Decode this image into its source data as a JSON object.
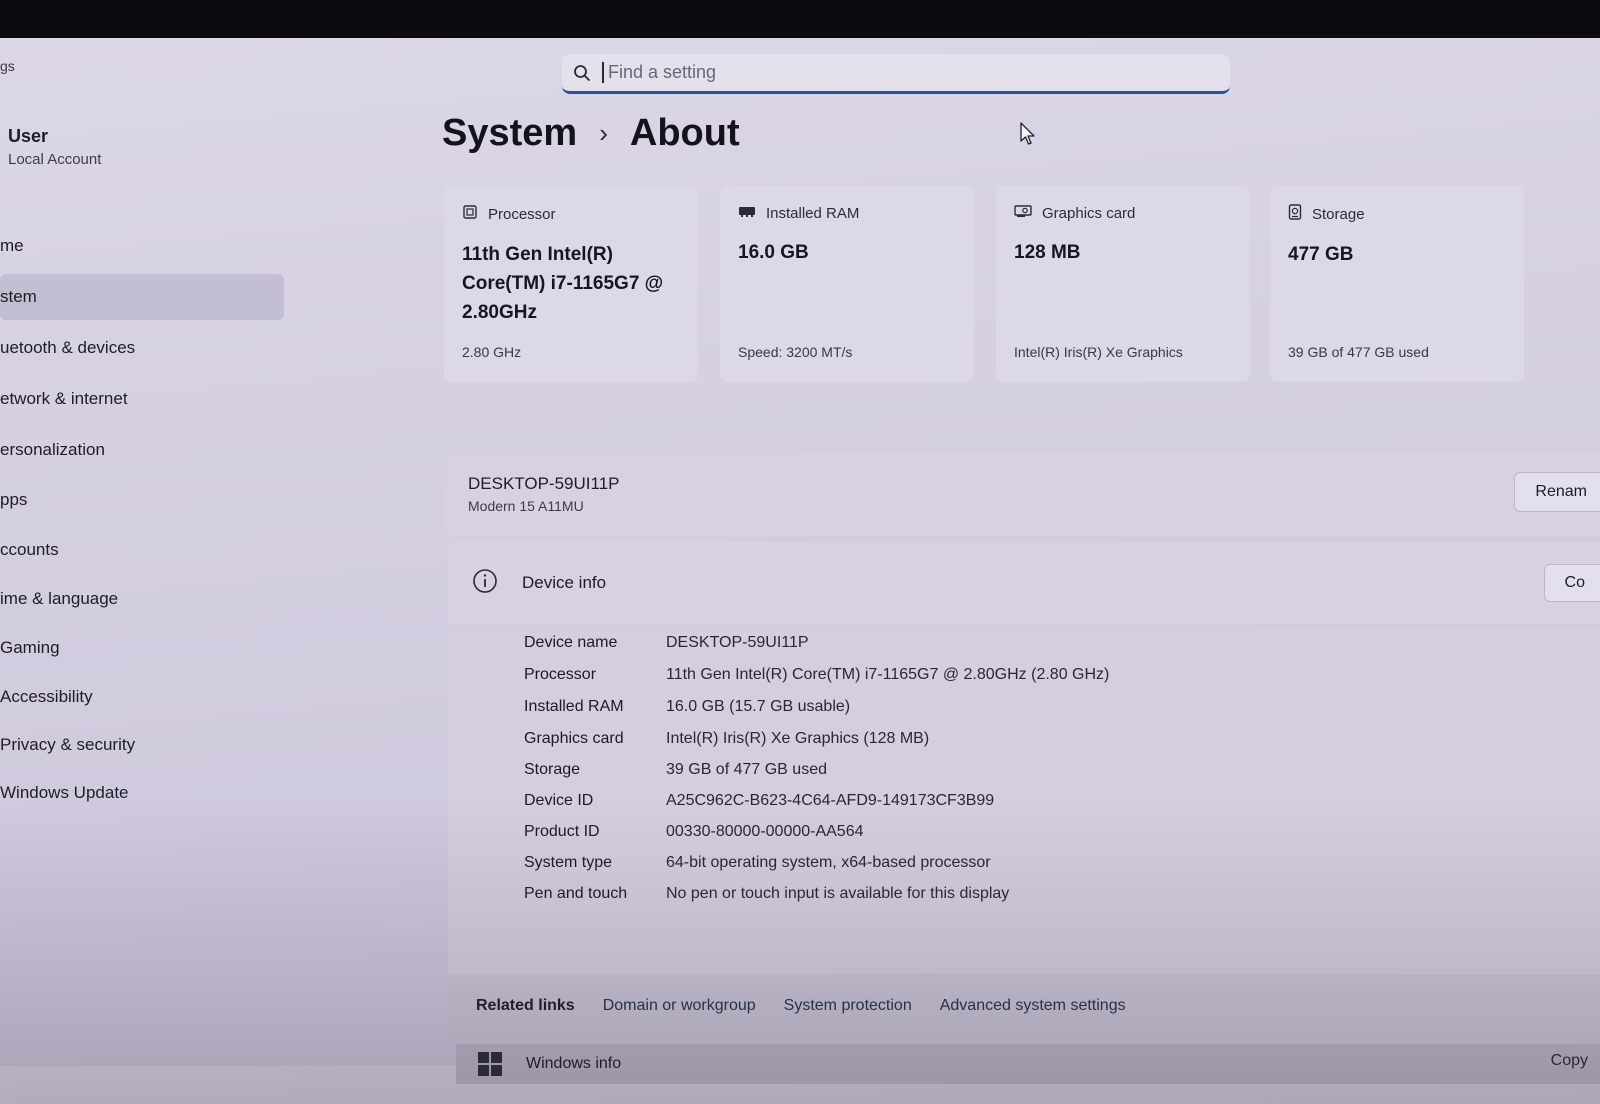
{
  "app": {
    "title_fragment": "gs"
  },
  "search": {
    "placeholder": "Find a setting"
  },
  "profile": {
    "name": "User",
    "account_type": "Local Account"
  },
  "sidebar": {
    "items": [
      {
        "label": "me",
        "active": false
      },
      {
        "label": "stem",
        "active": true
      },
      {
        "label": "uetooth & devices",
        "active": false
      },
      {
        "label": "etwork & internet",
        "active": false
      },
      {
        "label": "ersonalization",
        "active": false
      },
      {
        "label": "pps",
        "active": false
      },
      {
        "label": "ccounts",
        "active": false
      },
      {
        "label": "ime & language",
        "active": false
      },
      {
        "label": "Gaming",
        "active": false
      },
      {
        "label": "Accessibility",
        "active": false
      },
      {
        "label": "Privacy & security",
        "active": false
      },
      {
        "label": "Windows Update",
        "active": false
      }
    ]
  },
  "header": {
    "section": "System",
    "separator": "›",
    "page": "About"
  },
  "cards": [
    {
      "icon": "processor-icon",
      "label": "Processor",
      "value": "11th Gen Intel(R) Core(TM) i7-1165G7 @ 2.80GHz",
      "footer": "2.80 GHz"
    },
    {
      "icon": "ram-icon",
      "label": "Installed RAM",
      "value": "16.0 GB",
      "footer": "Speed: 3200 MT/s"
    },
    {
      "icon": "graphics-card-icon",
      "label": "Graphics card",
      "value": "128 MB",
      "footer": "Intel(R) Iris(R) Xe Graphics"
    },
    {
      "icon": "storage-icon",
      "label": "Storage",
      "value": "477 GB",
      "footer": "39 GB of 477 GB used"
    }
  ],
  "device": {
    "name": "DESKTOP-59UI11P",
    "model": "Modern 15 A11MU",
    "rename_label": "Renam"
  },
  "device_info": {
    "title": "Device info",
    "copy_label": "Co",
    "rows": [
      {
        "label": "Device name",
        "value": "DESKTOP-59UI11P"
      },
      {
        "label": "Processor",
        "value": "11th Gen Intel(R) Core(TM) i7-1165G7 @ 2.80GHz (2.80 GHz)"
      },
      {
        "label": "Installed RAM",
        "value": "16.0 GB (15.7 GB usable)"
      },
      {
        "label": "Graphics card",
        "value": "Intel(R) Iris(R) Xe Graphics (128 MB)"
      },
      {
        "label": "Storage",
        "value": "39 GB of 477 GB used"
      },
      {
        "label": "Device ID",
        "value": "A25C962C-B623-4C64-AFD9-149173CF3B99"
      },
      {
        "label": "Product ID",
        "value": "00330-80000-00000-AA564"
      },
      {
        "label": "System type",
        "value": "64-bit operating system, x64-based processor"
      },
      {
        "label": "Pen and touch",
        "value": "No pen or touch input is available for this display"
      }
    ]
  },
  "related_links": {
    "label": "Related links",
    "links": [
      "Domain or workgroup",
      "System protection",
      "Advanced system settings"
    ]
  },
  "windows_info": {
    "title": "Windows info",
    "copy_label": "Copy"
  }
}
